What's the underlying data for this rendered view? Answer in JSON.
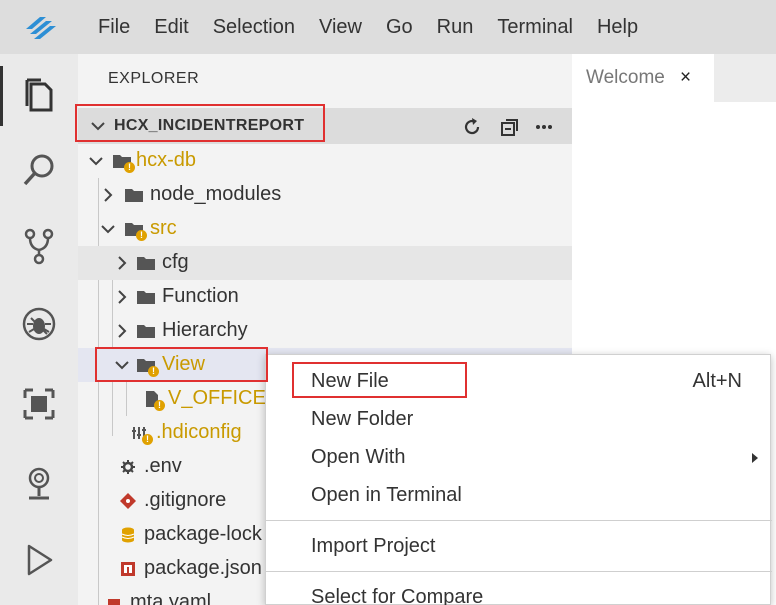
{
  "menubar": {
    "logo_icon": "app-logo-icon",
    "items": [
      "File",
      "Edit",
      "Selection",
      "View",
      "Go",
      "Run",
      "Terminal",
      "Help"
    ]
  },
  "activity_icons": [
    "explorer-icon",
    "search-icon",
    "source-control-icon",
    "debug-icon",
    "extensions-icon",
    "remote-icon",
    "run-icon"
  ],
  "sidebar": {
    "title": "EXPLORER",
    "project": "HCX_INCIDENTREPORT",
    "project_actions": [
      "refresh-icon",
      "collapse-all-icon",
      "more-icon"
    ],
    "tree": [
      {
        "label": "hcx-db",
        "modified": true
      },
      {
        "label": "node_modules",
        "modified": false
      },
      {
        "label": "src",
        "modified": true
      },
      {
        "label": "cfg",
        "modified": false
      },
      {
        "label": "Function",
        "modified": false
      },
      {
        "label": "Hierarchy",
        "modified": false
      },
      {
        "label": "View",
        "modified": true
      },
      {
        "label": "V_OFFICE",
        "modified": true
      },
      {
        "label": ".hdiconfig",
        "modified": true
      },
      {
        "label": ".env",
        "modified": false
      },
      {
        "label": ".gitignore",
        "modified": false
      },
      {
        "label": "package-lock",
        "modified": false
      },
      {
        "label": "package.json",
        "modified": false
      },
      {
        "label": "mta.yaml",
        "modified": false
      }
    ]
  },
  "editor": {
    "tabs": [
      {
        "label": "Welcome",
        "close": "×"
      }
    ]
  },
  "context_menu": {
    "items": [
      {
        "label": "New File",
        "shortcut": "Alt+N"
      },
      {
        "label": "New Folder",
        "shortcut": ""
      },
      {
        "label": "Open With",
        "shortcut": ""
      },
      {
        "label": "Open in Terminal",
        "shortcut": ""
      },
      {
        "label": "Import Project",
        "shortcut": ""
      },
      {
        "label": "Select for Compare",
        "shortcut": ""
      }
    ]
  },
  "colors": {
    "modified": "#c99a00",
    "badge": "#e0a100",
    "highlight_box": "#e03030",
    "accent": "#2d8fd5"
  }
}
